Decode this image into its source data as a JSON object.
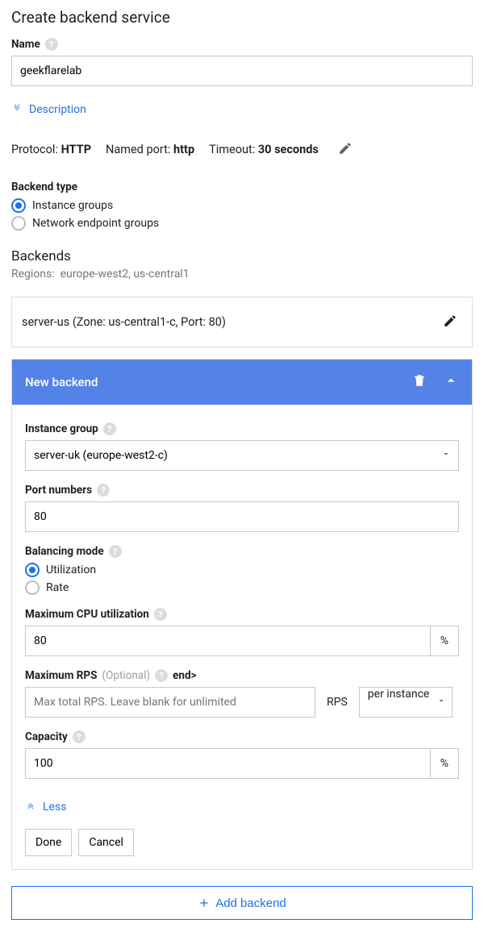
{
  "page": {
    "title": "Create backend service"
  },
  "name": {
    "label": "Name",
    "value": "geekflarelab"
  },
  "description": {
    "toggle_label": "Description"
  },
  "settings": {
    "protocol_label": "Protocol:",
    "protocol_value": "HTTP",
    "named_port_label": "Named port:",
    "named_port_value": "http",
    "timeout_label": "Timeout:",
    "timeout_value": "30 seconds"
  },
  "backend_type": {
    "label": "Backend type",
    "options": {
      "instance_groups": "Instance groups",
      "network_endpoint_groups": "Network endpoint groups"
    },
    "selected": "instance_groups"
  },
  "backends": {
    "title": "Backends",
    "regions_label": "Regions:",
    "regions_value": "europe-west2, us-central1",
    "existing": {
      "summary": "server-us (Zone: us-central1-c, Port: 80)"
    }
  },
  "new_backend": {
    "title": "New backend",
    "instance_group": {
      "label": "Instance group",
      "value": "server-uk (europe-west2-c)"
    },
    "port_numbers": {
      "label": "Port numbers",
      "value": "80"
    },
    "balancing_mode": {
      "label": "Balancing mode",
      "options": {
        "utilization": "Utilization",
        "rate": "Rate"
      },
      "selected": "utilization"
    },
    "max_cpu": {
      "label": "Maximum CPU utilization",
      "value": "80",
      "suffix": "%"
    },
    "max_rps": {
      "label": "Maximum RPS",
      "optional": "(Optional)",
      "placeholder": "Max total RPS. Leave blank for unlimited",
      "unit_label": "RPS",
      "scope": "per instance"
    },
    "capacity": {
      "label": "Capacity",
      "value": "100",
      "suffix": "%"
    },
    "less_label": "Less",
    "done_label": "Done",
    "cancel_label": "Cancel"
  },
  "add_backend": {
    "label": "Add backend"
  }
}
